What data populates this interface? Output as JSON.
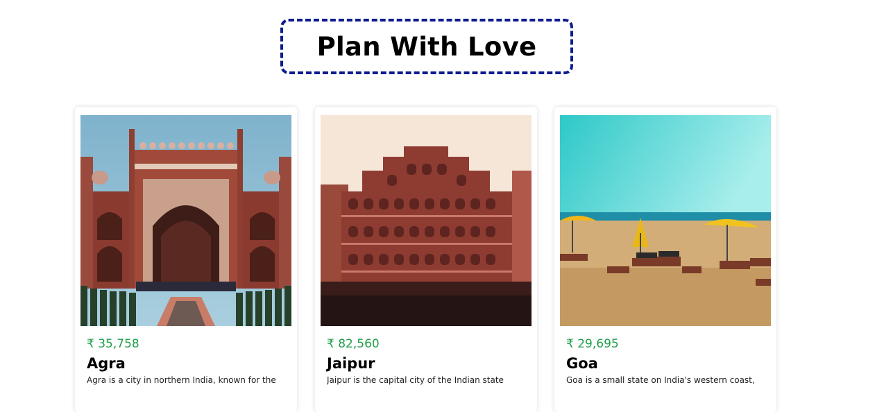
{
  "header": {
    "title": "Plan With Love"
  },
  "tours": [
    {
      "price": "₹ 35,758",
      "name": "Agra",
      "description": "Agra is a city in northern India, known for the",
      "image_icon": "taj-mahal-gate-image"
    },
    {
      "price": "₹ 82,560",
      "name": "Jaipur",
      "description": "Jaipur is the capital city of the Indian state",
      "image_icon": "hawa-mahal-image"
    },
    {
      "price": "₹ 29,695",
      "name": "Goa",
      "description": "Goa is a small state on India's western coast,",
      "image_icon": "goa-beach-image"
    }
  ],
  "colors": {
    "title_border": "#0b1a8f",
    "price": "#1f9e4b"
  }
}
